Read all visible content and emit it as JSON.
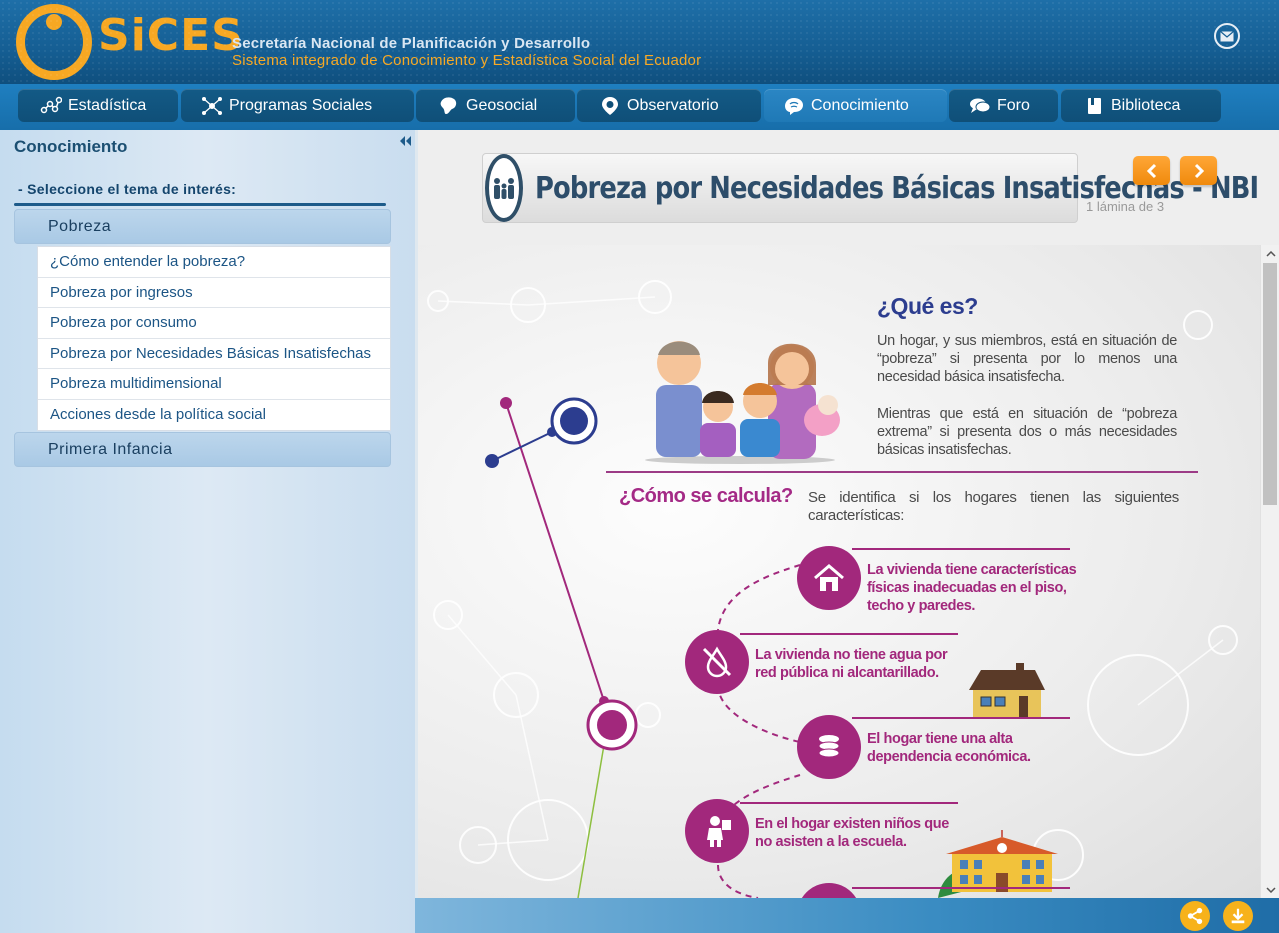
{
  "header": {
    "logo_text": "SiCES",
    "title_line1": "Secretaría Nacional de Planificación y Desarrollo",
    "title_line2": "Sistema integrado de Conocimiento y Estadística Social del Ecuador"
  },
  "nav": {
    "items": [
      {
        "label": "Estadística",
        "icon": "network-icon"
      },
      {
        "label": "Programas Sociales",
        "icon": "molecule-icon"
      },
      {
        "label": "Geosocial",
        "icon": "map-icon"
      },
      {
        "label": "Observatorio",
        "icon": "location-icon"
      },
      {
        "label": "Conocimiento",
        "icon": "brain-icon",
        "active": true
      },
      {
        "label": "Foro",
        "icon": "chat-icon"
      },
      {
        "label": "Biblioteca",
        "icon": "book-icon"
      }
    ]
  },
  "sidebar": {
    "title": "Conocimiento",
    "topic_label": "- Seleccione el tema de interés:",
    "categories": [
      {
        "label": "Pobreza",
        "items": [
          "¿Cómo entender la pobreza?",
          "Pobreza por ingresos",
          "Pobreza por consumo",
          "Pobreza por Necesidades Básicas Insatisfechas",
          "Pobreza multidimensional",
          "Acciones desde la política social"
        ]
      },
      {
        "label": "Primera Infancia",
        "items": []
      }
    ]
  },
  "slide": {
    "banner_title": "Pobreza por Necesidades Básicas Insatisfechas - NBI",
    "counter": "1 lámina de 3",
    "que_title": "¿Qué es?",
    "que_p1": "Un hogar, y sus miembros, está en situación de “pobreza” si presenta por lo menos una necesidad básica insatisfecha.",
    "que_p2": "Mientras que está en situación de “pobreza extrema” si presenta dos o más necesidades básicas insatisfechas.",
    "como_title": "¿Cómo se calcula?",
    "como_p": "Se identifica si los hogares tienen las siguientes características:",
    "features": [
      "La vivienda tiene características físicas inadecuadas en el piso, techo y paredes.",
      "La vivienda no tiene agua por red pública ni alcantarillado.",
      "El hogar tiene una alta dependencia económica.",
      "En el hogar existen niños que no asisten a la escuela."
    ]
  },
  "colors": {
    "brand_orange": "#f7a823",
    "header_blue": "#155e93",
    "accent_magenta": "#a2287c",
    "title_navy": "#2c3d8f"
  }
}
